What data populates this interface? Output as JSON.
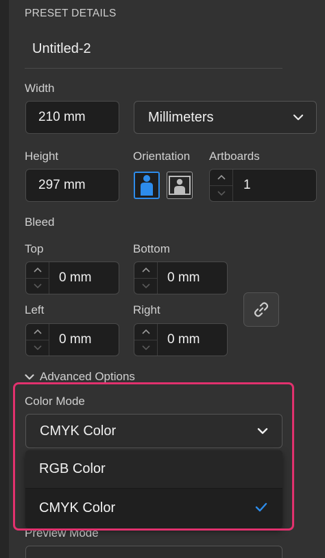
{
  "preset": {
    "section_title": "PRESET DETAILS",
    "name": "Untitled-2"
  },
  "width": {
    "label": "Width",
    "value": "210 mm"
  },
  "units": {
    "selected": "Millimeters"
  },
  "height": {
    "label": "Height",
    "value": "297 mm"
  },
  "orientation": {
    "label": "Orientation",
    "selected": "portrait"
  },
  "artboards": {
    "label": "Artboards",
    "value": "1"
  },
  "bleed": {
    "label": "Bleed",
    "top": {
      "label": "Top",
      "value": "0 mm"
    },
    "bottom": {
      "label": "Bottom",
      "value": "0 mm"
    },
    "left": {
      "label": "Left",
      "value": "0 mm"
    },
    "right": {
      "label": "Right",
      "value": "0 mm"
    }
  },
  "advanced": {
    "label": "Advanced Options"
  },
  "color_mode": {
    "label": "Color Mode",
    "selected": "CMYK Color",
    "options": [
      "RGB Color",
      "CMYK Color"
    ]
  },
  "preview_mode": {
    "label": "Preview Mode"
  },
  "colors": {
    "accent_blue": "#2d8ceb",
    "highlight": "#e2316e",
    "background": "#323232"
  }
}
